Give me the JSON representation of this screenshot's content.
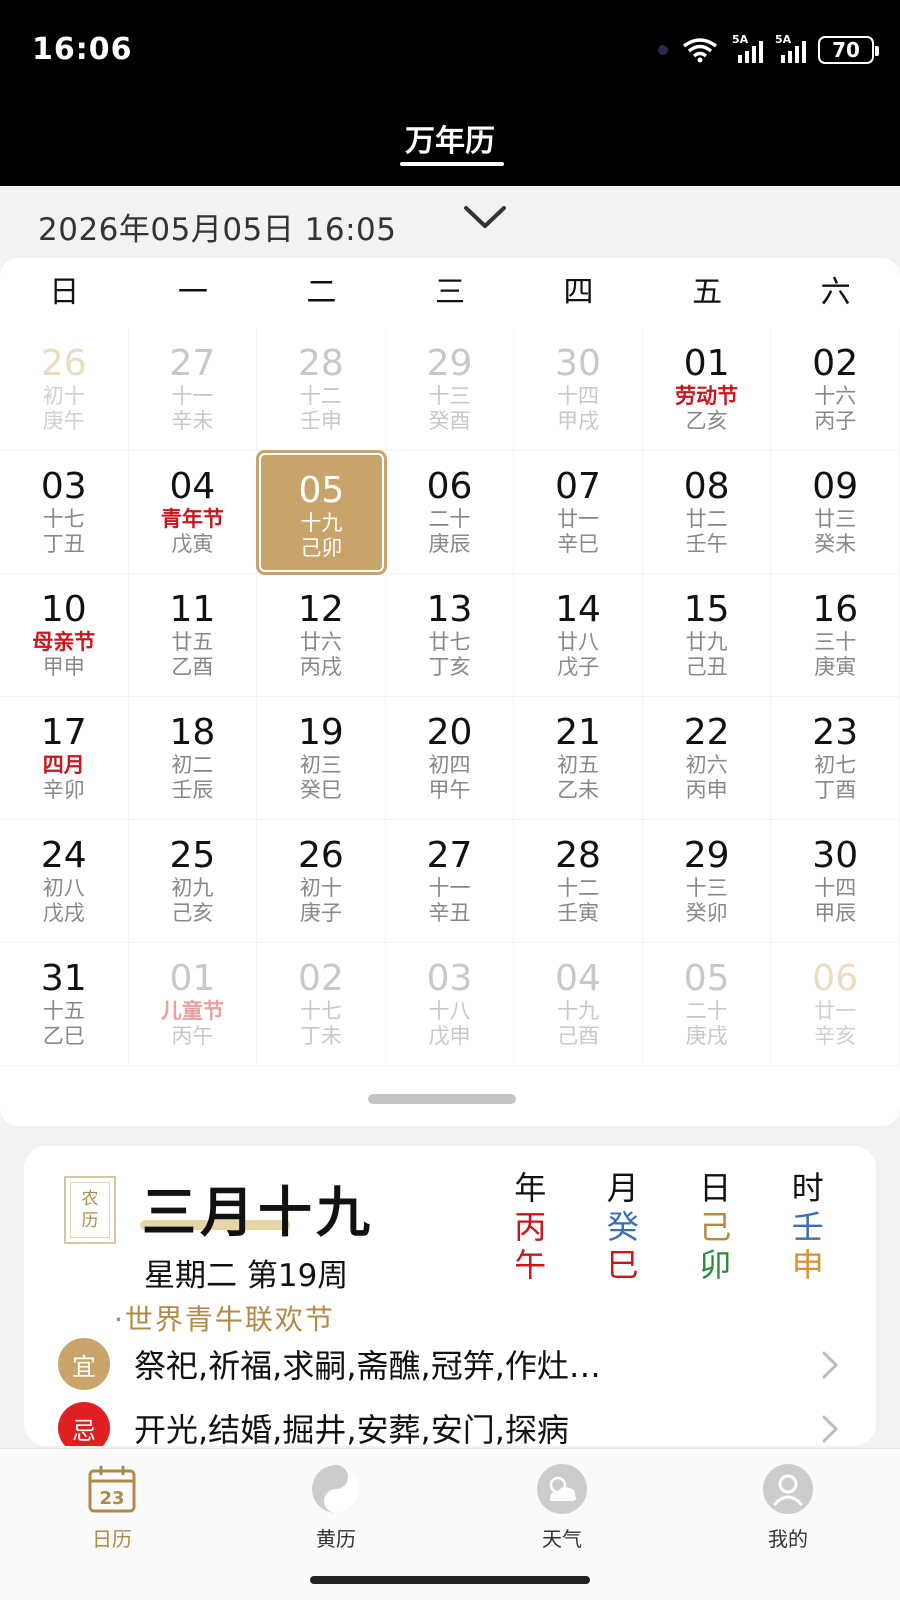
{
  "status": {
    "time": "16:06",
    "sig1": "5A",
    "sig2": "5A",
    "battery": "70"
  },
  "app": {
    "title": "万年历"
  },
  "datebar": {
    "text": "2026年05月05日 16:05"
  },
  "weekdays": [
    "日",
    "一",
    "二",
    "三",
    "四",
    "五",
    "六"
  ],
  "calendar": [
    {
      "num": "26",
      "lunar": "初十",
      "gz": "庚午",
      "state": "weekend-dim"
    },
    {
      "num": "27",
      "lunar": "十一",
      "gz": "辛未",
      "state": "dim"
    },
    {
      "num": "28",
      "lunar": "十二",
      "gz": "壬申",
      "state": "dim"
    },
    {
      "num": "29",
      "lunar": "十三",
      "gz": "癸酉",
      "state": "dim"
    },
    {
      "num": "30",
      "lunar": "十四",
      "gz": "甲戌",
      "state": "dim"
    },
    {
      "num": "01",
      "lunar": "劳动节",
      "gz": "乙亥",
      "state": "",
      "fest": true
    },
    {
      "num": "02",
      "lunar": "十六",
      "gz": "丙子",
      "state": ""
    },
    {
      "num": "03",
      "lunar": "十七",
      "gz": "丁丑",
      "state": ""
    },
    {
      "num": "04",
      "lunar": "青年节",
      "gz": "戊寅",
      "state": "",
      "fest": true
    },
    {
      "num": "05",
      "lunar": "十九",
      "gz": "己卯",
      "state": "today"
    },
    {
      "num": "06",
      "lunar": "二十",
      "gz": "庚辰",
      "state": ""
    },
    {
      "num": "07",
      "lunar": "廿一",
      "gz": "辛巳",
      "state": ""
    },
    {
      "num": "08",
      "lunar": "廿二",
      "gz": "壬午",
      "state": ""
    },
    {
      "num": "09",
      "lunar": "廿三",
      "gz": "癸未",
      "state": ""
    },
    {
      "num": "10",
      "lunar": "母亲节",
      "gz": "甲申",
      "state": "",
      "fest": true
    },
    {
      "num": "11",
      "lunar": "廿五",
      "gz": "乙酉",
      "state": ""
    },
    {
      "num": "12",
      "lunar": "廿六",
      "gz": "丙戌",
      "state": ""
    },
    {
      "num": "13",
      "lunar": "廿七",
      "gz": "丁亥",
      "state": ""
    },
    {
      "num": "14",
      "lunar": "廿八",
      "gz": "戊子",
      "state": ""
    },
    {
      "num": "15",
      "lunar": "廿九",
      "gz": "己丑",
      "state": ""
    },
    {
      "num": "16",
      "lunar": "三十",
      "gz": "庚寅",
      "state": ""
    },
    {
      "num": "17",
      "lunar": "四月",
      "gz": "辛卯",
      "state": "",
      "fest": true
    },
    {
      "num": "18",
      "lunar": "初二",
      "gz": "壬辰",
      "state": ""
    },
    {
      "num": "19",
      "lunar": "初三",
      "gz": "癸巳",
      "state": ""
    },
    {
      "num": "20",
      "lunar": "初四",
      "gz": "甲午",
      "state": ""
    },
    {
      "num": "21",
      "lunar": "初五",
      "gz": "乙未",
      "state": ""
    },
    {
      "num": "22",
      "lunar": "初六",
      "gz": "丙申",
      "state": ""
    },
    {
      "num": "23",
      "lunar": "初七",
      "gz": "丁酉",
      "state": ""
    },
    {
      "num": "24",
      "lunar": "初八",
      "gz": "戊戌",
      "state": ""
    },
    {
      "num": "25",
      "lunar": "初九",
      "gz": "己亥",
      "state": ""
    },
    {
      "num": "26",
      "lunar": "初十",
      "gz": "庚子",
      "state": ""
    },
    {
      "num": "27",
      "lunar": "十一",
      "gz": "辛丑",
      "state": ""
    },
    {
      "num": "28",
      "lunar": "十二",
      "gz": "壬寅",
      "state": ""
    },
    {
      "num": "29",
      "lunar": "十三",
      "gz": "癸卯",
      "state": ""
    },
    {
      "num": "30",
      "lunar": "十四",
      "gz": "甲辰",
      "state": ""
    },
    {
      "num": "31",
      "lunar": "十五",
      "gz": "乙巳",
      "state": ""
    },
    {
      "num": "01",
      "lunar": "儿童节",
      "gz": "丙午",
      "state": "dim",
      "fest": true
    },
    {
      "num": "02",
      "lunar": "十七",
      "gz": "丁未",
      "state": "dim"
    },
    {
      "num": "03",
      "lunar": "十八",
      "gz": "戊申",
      "state": "dim"
    },
    {
      "num": "04",
      "lunar": "十九",
      "gz": "己酉",
      "state": "dim"
    },
    {
      "num": "05",
      "lunar": "二十",
      "gz": "庚戌",
      "state": "dim"
    },
    {
      "num": "06",
      "lunar": "廿一",
      "gz": "辛亥",
      "state": "weekend-dim"
    }
  ],
  "detail": {
    "badge_top": "农",
    "badge_bottom": "历",
    "lunar_date": "三月十九",
    "week_line": "星期二 第19周",
    "festival": "·世界青牛联欢节",
    "ganzhi": [
      {
        "head": "年",
        "top": "丙",
        "bottom": "午",
        "top_color": "#c8161d",
        "bottom_color": "#c8161d"
      },
      {
        "head": "月",
        "top": "癸",
        "bottom": "巳",
        "top_color": "#3b6fb5",
        "bottom_color": "#c8161d"
      },
      {
        "head": "日",
        "top": "己",
        "bottom": "卯",
        "top_color": "#b58a3a",
        "bottom_color": "#2e8b3a"
      },
      {
        "head": "时",
        "top": "壬",
        "bottom": "申",
        "top_color": "#3b6fb5",
        "bottom_color": "#d8922c"
      }
    ],
    "yi": {
      "tag": "宜",
      "text": "祭祀,祈福,求嗣,斋醮,冠笄,作灶…",
      "color": "#c9a46a"
    },
    "ji": {
      "tag": "忌",
      "text": "开光,结婚,掘井,安葬,安门,探病",
      "color": "#e02020"
    }
  },
  "tabs": [
    {
      "label": "日历",
      "icon": "calendar-icon",
      "badge": "23"
    },
    {
      "label": "黄历",
      "icon": "yinyang-icon"
    },
    {
      "label": "天气",
      "icon": "weather-icon"
    },
    {
      "label": "我的",
      "icon": "profile-icon"
    }
  ]
}
